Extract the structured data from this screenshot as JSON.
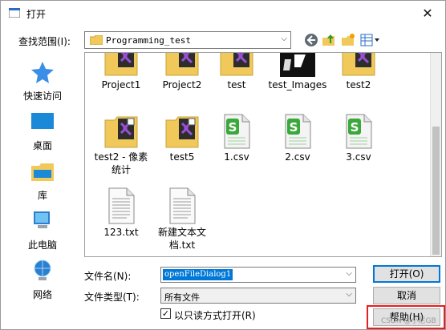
{
  "window": {
    "title": "打开",
    "close_glyph": "✕"
  },
  "lookin": {
    "label": "查找范围(I):",
    "value": "Programming_test"
  },
  "places": [
    {
      "label": "快速访问",
      "icon": "star-icon"
    },
    {
      "label": "桌面",
      "icon": "desktop-icon"
    },
    {
      "label": "库",
      "icon": "library-icon"
    },
    {
      "label": "此电脑",
      "icon": "computer-icon"
    },
    {
      "label": "网络",
      "icon": "network-icon"
    }
  ],
  "files": [
    {
      "name": "Project1",
      "icon": "vs-project-folder-icon"
    },
    {
      "name": "Project2",
      "icon": "vs-project-folder-icon"
    },
    {
      "name": "test",
      "icon": "vs-project-folder-icon"
    },
    {
      "name": "test_Images",
      "icon": "image-folder-icon"
    },
    {
      "name": "test2",
      "icon": "vs-project-folder-icon"
    },
    {
      "name": "test2 - 像素统计",
      "icon": "vs-project-folder-icon"
    },
    {
      "name": "test5",
      "icon": "vs-project-folder-icon"
    },
    {
      "name": "1.csv",
      "icon": "csv-file-icon"
    },
    {
      "name": "2.csv",
      "icon": "csv-file-icon"
    },
    {
      "name": "3.csv",
      "icon": "csv-file-icon"
    },
    {
      "name": "123.txt",
      "icon": "text-file-icon"
    },
    {
      "name": "新建文本文档.txt",
      "icon": "text-file-icon"
    }
  ],
  "filename": {
    "label": "文件名(N):",
    "value": "openFileDialog1"
  },
  "filetype": {
    "label": "文件类型(T):",
    "value": "所有文件"
  },
  "readonly": {
    "label": "以只读方式打开(R)",
    "checked_glyph": "✓"
  },
  "buttons": {
    "open": "打开(O)",
    "cancel": "取消",
    "help": "帮助(H)"
  },
  "watermark": "CSDN @小尼GB",
  "colors": {
    "selection": "#0078d7",
    "highlight_box": "#e81e1e"
  }
}
